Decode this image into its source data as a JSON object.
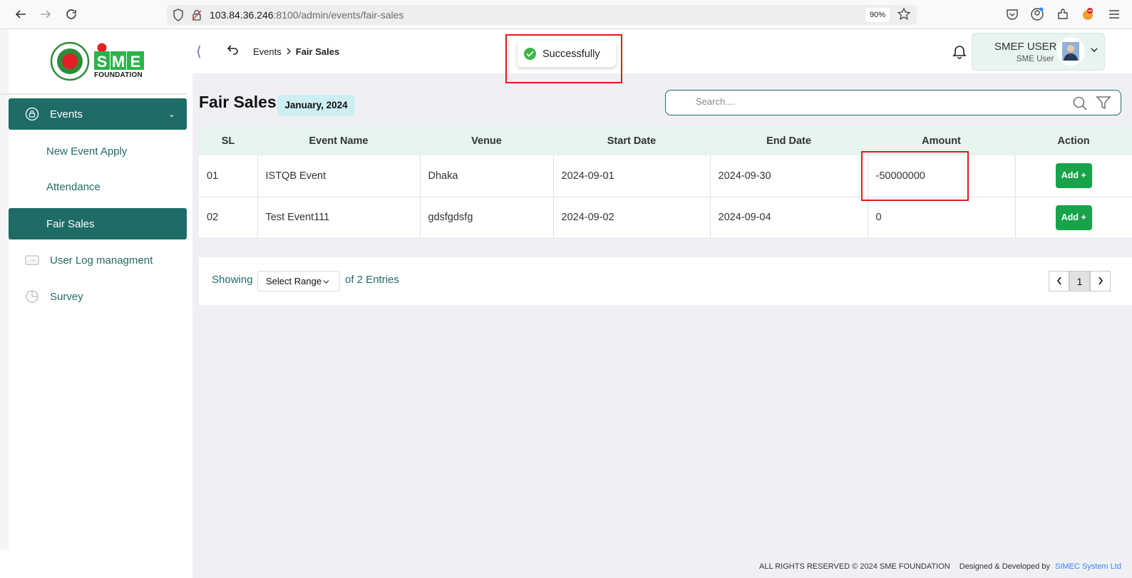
{
  "browser": {
    "url_host": "103.84.36.246",
    "url_rest": ":8100/admin/events/fair-sales",
    "zoom": "90%"
  },
  "sidebar": {
    "logo_text": "FOUNDATION",
    "items": [
      {
        "label": "Events",
        "icon": "lock-badge-icon",
        "active": true,
        "expanded": true
      },
      {
        "label": "New Event Apply"
      },
      {
        "label": "Attendance"
      },
      {
        "label": "Fair Sales",
        "active": true
      },
      {
        "label": "User Log managment",
        "icon": "log-icon"
      },
      {
        "label": "Survey",
        "icon": "pie-icon"
      }
    ]
  },
  "header": {
    "breadcrumb_parent": "Events",
    "breadcrumb_current": "Fair Sales",
    "user_name": "SMEF USER",
    "user_role": "SME User"
  },
  "toast": {
    "message": "Successfully",
    "status_color": "#3bb54a"
  },
  "main": {
    "title": "Fair Sales",
    "month": "January, 2024",
    "search_placeholder": "Search....",
    "columns": [
      "SL",
      "Event Name",
      "Venue",
      "Start Date",
      "End Date",
      "Amount",
      "Action"
    ],
    "rows": [
      {
        "sl": "01",
        "event": "ISTQB Event",
        "venue": "Dhaka",
        "start": "2024-09-01",
        "end": "2024-09-30",
        "amount": "-50000000",
        "action": "Add +"
      },
      {
        "sl": "02",
        "event": "Test Event111",
        "venue": "gdsfgdsfg",
        "start": "2024-09-02",
        "end": "2024-09-04",
        "amount": "0",
        "action": "Add +"
      }
    ],
    "pagination": {
      "showing": "Showing",
      "range_select": "Select Range",
      "entries": "of 2 Entries",
      "current_page": "1"
    }
  },
  "footer": {
    "rights": "ALL RIGHTS RESERVED © 2024 SME FOUNDATION",
    "designed": "Designed & Developed by",
    "company": "SIMEC System Ltd"
  },
  "colors": {
    "accent": "#1f6b66",
    "header_row": "#e6f5ee",
    "add_button": "#16a34a",
    "highlight": "#e31b1b"
  }
}
